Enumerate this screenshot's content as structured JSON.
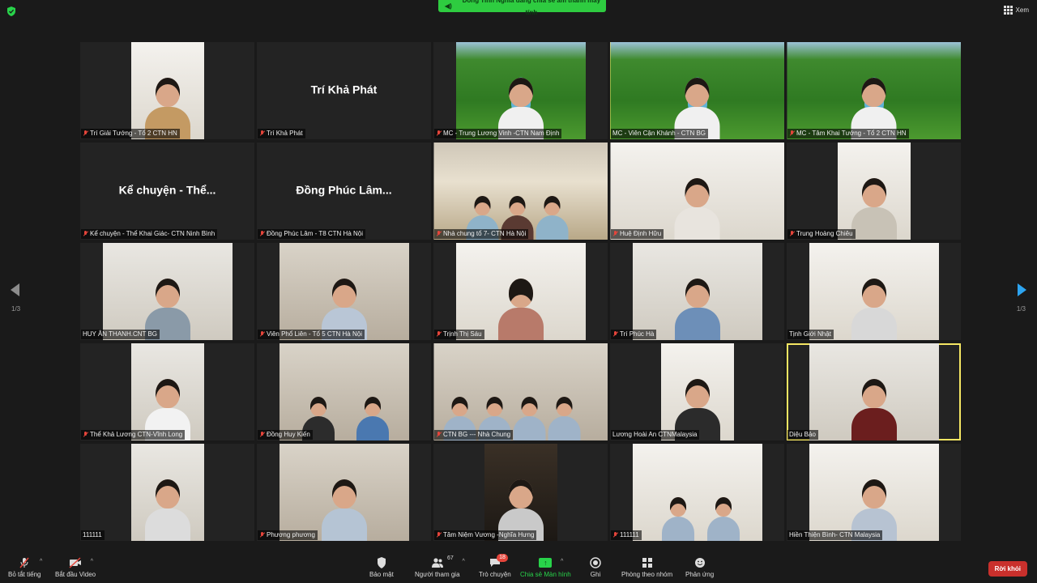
{
  "header": {
    "share_banner": "Dong Tinh Nghia đang chia sẻ âm thanh máy tính",
    "view_label": "Xem"
  },
  "colors": {
    "accent": "#2ecc40",
    "active_speaker": "#f5e663",
    "muted": "#e5453b",
    "leave": "#c9302c",
    "next_arrow": "#2da4f0"
  },
  "pagination": {
    "left": "1/3",
    "right": "1/3"
  },
  "tiles": [
    {
      "label": "Trí Giải Tướng  - Tổ 2 CTN HN",
      "muted": true
    },
    {
      "label": "Trí Khả Phát",
      "muted": true,
      "name_text": "Trí Khả Phát"
    },
    {
      "label": "MC - Trung Lương Vinh -CTN Nam Định",
      "muted": true
    },
    {
      "label": "MC - Viên Cận Khánh - CTN BG",
      "muted": false,
      "active": true
    },
    {
      "label": "MC - Tâm Khai Tướng - Tổ 2 CTN HN",
      "muted": true
    },
    {
      "label": "Kể chuyện - Thể Khai Giác- CTN Ninh Bình",
      "muted": true,
      "name_text": "Kể chuyện - Thể..."
    },
    {
      "label": "Đồng Phúc Lâm - T8 CTN Hà Nội",
      "muted": true,
      "name_text": "Đồng Phúc Lâm..."
    },
    {
      "label": "Nhà chung tổ 7- CTN Hà Nội",
      "muted": true
    },
    {
      "label": "Huệ Định Hữu",
      "muted": true
    },
    {
      "label": "Trung Hoàng Chiêu",
      "muted": true
    },
    {
      "label": "HUY ÂN THANH.CNT BG",
      "muted": false
    },
    {
      "label": "Viên Phổ Liên - Tổ 5 CTN Hà Nội",
      "muted": true
    },
    {
      "label": "Trịnh Thị Sáu",
      "muted": true
    },
    {
      "label": "Trí Phúc Hà",
      "muted": true
    },
    {
      "label": "Tịnh Giới Nhật",
      "muted": false
    },
    {
      "label": "Thể Khả Lương CTN-Vĩnh Long",
      "muted": true
    },
    {
      "label": "Đồng Huy Kiến",
      "muted": true
    },
    {
      "label": "CTN BG --- Nhà Chung",
      "muted": true
    },
    {
      "label": "Lương Hoài An CTNMalaysia",
      "muted": false
    },
    {
      "label": "Diệu Bảo",
      "muted": false
    },
    {
      "label": "111111",
      "muted": false
    },
    {
      "label": "Phương phương",
      "muted": true
    },
    {
      "label": "Tâm Niệm Vương -Nghĩa Hưng",
      "muted": true
    },
    {
      "label": "111111",
      "muted": true
    },
    {
      "label": "Hiền Thiện Bình- CTN Malaysia",
      "muted": false
    }
  ],
  "toolbar": {
    "unmute": "Bỏ tắt tiếng",
    "start_video": "Bắt đầu Video",
    "security": "Bảo mật",
    "participants": "Người tham gia",
    "participants_count": "67",
    "chat": "Trò chuyện",
    "chat_badge": "18",
    "share_screen": "Chia sẻ Màn hình",
    "record": "Ghi",
    "breakout": "Phòng theo nhóm",
    "reactions": "Phản ứng",
    "leave": "Rời khỏi"
  }
}
